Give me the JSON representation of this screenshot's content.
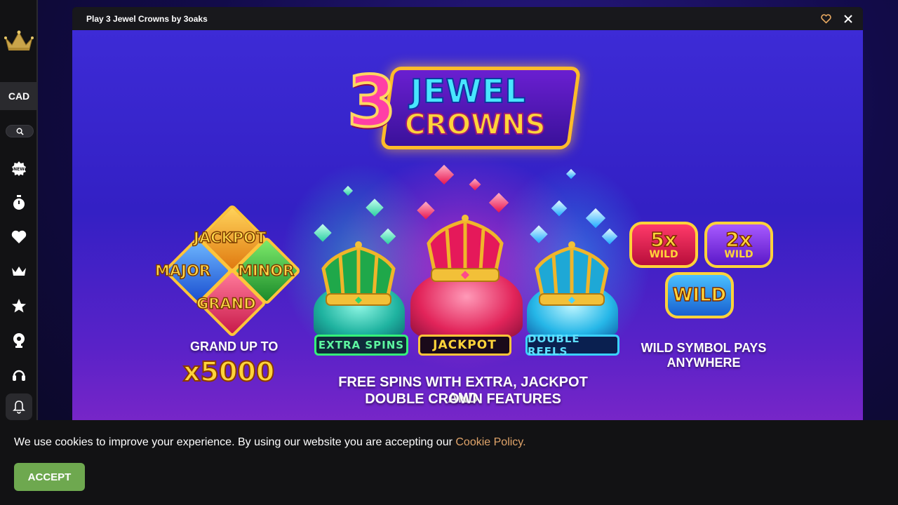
{
  "sidebar": {
    "currency": "CAD",
    "icons": [
      "crown-logo-icon",
      "search-icon",
      "new-badge-icon",
      "stopwatch-icon",
      "heart-icon",
      "crown-icon",
      "star-icon",
      "trophy-icon",
      "headset-icon",
      "bell-icon"
    ]
  },
  "game": {
    "window_title": "Play 3 Jewel Crowns by 3oaks",
    "title": {
      "number": "3",
      "word1": "JEWEL",
      "word2": "CROWNS"
    },
    "jackpots": {
      "top": "JACKPOT",
      "left": "MAJOR",
      "right": "MINOR",
      "bottom": "GRAND"
    },
    "grand_caption": "GRAND UP TO",
    "grand_multiplier": "x5000",
    "features": {
      "left": "EXTRA SPINS",
      "center": "JACKPOT",
      "right": "DOUBLE REELS"
    },
    "free_spins_caption_line1": "FREE SPINS WITH EXTRA, JACKPOT AND",
    "free_spins_caption_line2": "DOUBLE CROWN FEATURES",
    "wilds": {
      "w1_mult": "5x",
      "w1_label": "WILD",
      "w2_mult": "2x",
      "w2_label": "WILD",
      "w3_label": "WILD"
    },
    "wild_caption_line1": "WILD SYMBOL PAYS",
    "wild_caption_line2": "ANYWHERE"
  },
  "cookie": {
    "message": "We use cookies to improve your experience. By using our website you are accepting our ",
    "link": "Cookie Policy.",
    "accept": "ACCEPT"
  },
  "colors": {
    "accent_gold": "#ffc53a",
    "accept_green": "#6ea84f",
    "cookie_link": "#e0a46a"
  }
}
